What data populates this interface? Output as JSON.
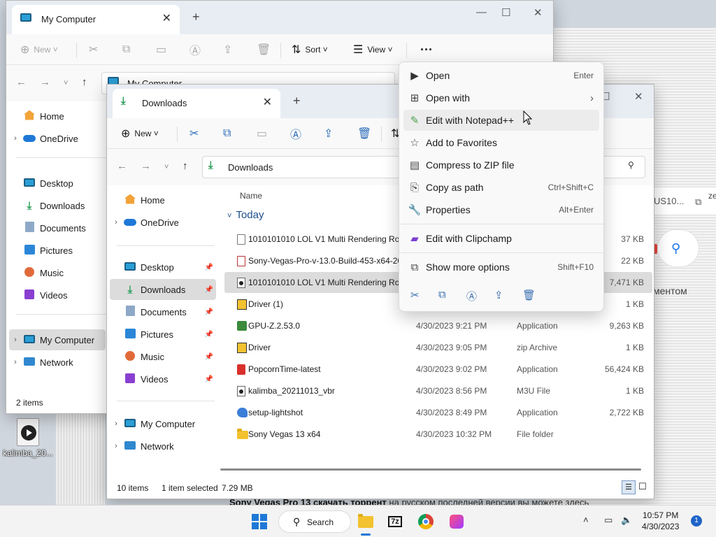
{
  "desktop": {
    "icon_label": "kalimba_20..."
  },
  "background": {
    "us_text": "US10...",
    "translate_icon": "translate-icon",
    "menty_text": "ментом",
    "russian_bold": "Sony Vegas Pro 13 скачать торрент",
    "russian_rest": " на русском последней версии вы можете здесь"
  },
  "mycomputer": {
    "tab_title": "My Computer",
    "cmd": {
      "new": "New",
      "sort": "Sort",
      "view": "View"
    },
    "address": "My Computer",
    "sidebar": [
      {
        "label": "Home",
        "icon": "home-icon"
      },
      {
        "label": "OneDrive",
        "icon": "cloud-icon"
      },
      {
        "label": "Desktop",
        "icon": "desktop-icon"
      },
      {
        "label": "Downloads",
        "icon": "download-icon"
      },
      {
        "label": "Documents",
        "icon": "documents-icon"
      },
      {
        "label": "Pictures",
        "icon": "pictures-icon"
      },
      {
        "label": "Music",
        "icon": "music-icon"
      },
      {
        "label": "Videos",
        "icon": "videos-icon"
      },
      {
        "label": "My Computer",
        "icon": "computer-icon"
      },
      {
        "label": "Network",
        "icon": "network-icon"
      }
    ],
    "status": "2 items"
  },
  "downloads": {
    "tab_title": "Downloads",
    "cmd": {
      "new": "New"
    },
    "address": "Downloads",
    "sidebar": [
      {
        "label": "Home"
      },
      {
        "label": "OneDrive"
      },
      {
        "label": "Desktop"
      },
      {
        "label": "Downloads"
      },
      {
        "label": "Documents"
      },
      {
        "label": "Pictures"
      },
      {
        "label": "Music"
      },
      {
        "label": "Videos"
      },
      {
        "label": "My Computer"
      },
      {
        "label": "Network"
      }
    ],
    "columns": {
      "name": "Name",
      "size": "ze"
    },
    "group": "Today",
    "files": [
      {
        "name": "1010101010 LOL V1 Multi Rendering Rou...",
        "date": "",
        "type": "",
        "size": "37 KB",
        "icon": "file-icon"
      },
      {
        "name": "Sony-Vegas-Pro-v-13.0-Build-453-x64-20...",
        "date": "",
        "type": "",
        "size": "22 KB",
        "icon": "file-icon"
      },
      {
        "name": "1010101010 LOL V1 Multi Rendering Rou...",
        "date": "",
        "type": "",
        "size": "7,471 KB",
        "icon": "media-file-icon"
      },
      {
        "name": "Driver (1)",
        "date": "",
        "type": "",
        "size": "1 KB",
        "icon": "zip-icon"
      },
      {
        "name": "GPU-Z.2.53.0",
        "date": "4/30/2023 9:21 PM",
        "type": "Application",
        "size": "9,263 KB",
        "icon": "app-icon"
      },
      {
        "name": "Driver",
        "date": "4/30/2023 9:05 PM",
        "type": "zip Archive",
        "size": "1 KB",
        "icon": "zip-icon"
      },
      {
        "name": "PopcornTime-latest",
        "date": "4/30/2023 9:02 PM",
        "type": "Application",
        "size": "56,424 KB",
        "icon": "popcorn-icon"
      },
      {
        "name": "kalimba_20211013_vbr",
        "date": "4/30/2023 8:56 PM",
        "type": "M3U File",
        "size": "1 KB",
        "icon": "m3u-icon"
      },
      {
        "name": "setup-lightshot",
        "date": "4/30/2023 8:49 PM",
        "type": "Application",
        "size": "2,722 KB",
        "icon": "lightshot-icon"
      },
      {
        "name": "Sony Vegas 13 x64",
        "date": "4/30/2023 10:32 PM",
        "type": "File folder",
        "size": "",
        "icon": "folder-icon"
      }
    ],
    "status": {
      "count": "10 items",
      "selected": "1 item selected",
      "size": "7.29 MB"
    }
  },
  "context_menu": {
    "items": [
      {
        "label": "Open",
        "shortcut": "Enter",
        "icon": "media-player-icon"
      },
      {
        "label": "Open with",
        "shortcut": "",
        "icon": "open-with-icon"
      },
      {
        "label": "Edit with Notepad++",
        "shortcut": "",
        "icon": "notepad-icon"
      },
      {
        "label": "Add to Favorites",
        "shortcut": "",
        "icon": "star-icon"
      },
      {
        "label": "Compress to ZIP file",
        "shortcut": "",
        "icon": "zip-icon"
      },
      {
        "label": "Copy as path",
        "shortcut": "Ctrl+Shift+C",
        "icon": "copy-path-icon"
      },
      {
        "label": "Properties",
        "shortcut": "Alt+Enter",
        "icon": "wrench-icon"
      },
      {
        "label": "Edit with Clipchamp",
        "shortcut": "",
        "icon": "clipchamp-icon"
      },
      {
        "label": "Show more options",
        "shortcut": "Shift+F10",
        "icon": "more-options-icon"
      }
    ]
  },
  "taskbar": {
    "search_label": "Search",
    "time": "10:57 PM",
    "date": "4/30/2023",
    "notifications": "1"
  }
}
